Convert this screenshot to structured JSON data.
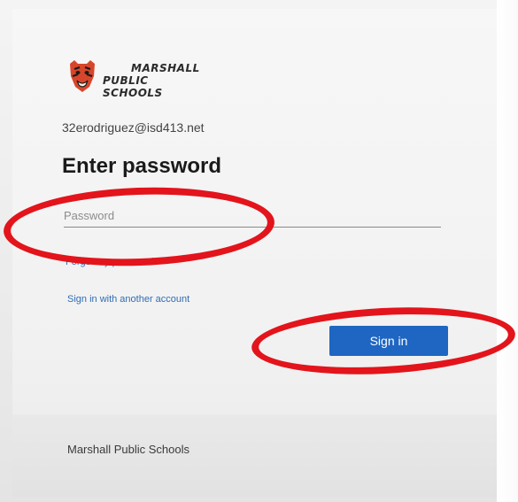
{
  "brand": {
    "logo_line1": "MARSHALL",
    "logo_line2": "PUBLIC SCHOOLS",
    "mascot_icon": "tiger-mascot-icon"
  },
  "identity": {
    "email": "32erodriguez@isd413.net"
  },
  "heading": {
    "title": "Enter password"
  },
  "password": {
    "placeholder": "Password",
    "value": ""
  },
  "links": {
    "forgot": "Forgot my password",
    "another_account": "Sign in with another account"
  },
  "actions": {
    "sign_in": "Sign in"
  },
  "footer": {
    "text": "Marshall Public Schools"
  },
  "colors": {
    "accent": "#1f66c2",
    "link": "#2f6db3",
    "annotation": "#e3141b"
  }
}
